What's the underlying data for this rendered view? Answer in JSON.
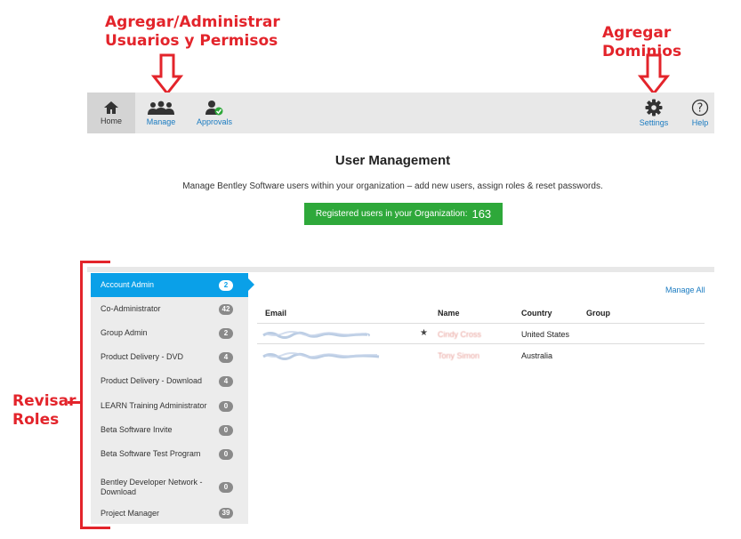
{
  "annotations": {
    "manage_note_line1": "Agregar/Administrar",
    "manage_note_line2": "Usuarios y Permisos",
    "settings_note": "Agregar Dominios",
    "roles_note_line1": "Revisar",
    "roles_note_line2": "Roles",
    "color": "#e3242b"
  },
  "toolbar": {
    "items": [
      {
        "label": "Home",
        "icon": "home-icon",
        "active": true
      },
      {
        "label": "Manage",
        "icon": "users-icon"
      },
      {
        "label": "Approvals",
        "icon": "user-check-icon"
      },
      {
        "label": "Settings",
        "icon": "gear-icon"
      },
      {
        "label": "Help",
        "icon": "help-icon"
      }
    ]
  },
  "page": {
    "title": "User Management",
    "subtitle": "Manage Bentley Software users within your organization – add new users, assign roles & reset passwords.",
    "registered_label": "Registered users in your Organization:",
    "registered_count": "163",
    "accent": "#2ea83a"
  },
  "roles": [
    {
      "label": "Account Admin",
      "count": "2",
      "active": true
    },
    {
      "label": "Co-Administrator",
      "count": "42"
    },
    {
      "label": "Group Admin",
      "count": "2"
    },
    {
      "label": "Product Delivery - DVD",
      "count": "4"
    },
    {
      "label": "Product Delivery - Download",
      "count": "4"
    },
    {
      "label": "LEARN Training Administrator",
      "count": "0"
    },
    {
      "label": "Beta Software Invite",
      "count": "0"
    },
    {
      "label": "Beta Software Test Program",
      "count": "0"
    },
    {
      "label": "Bentley Developer Network - Download",
      "count": "0"
    },
    {
      "label": "Project Manager",
      "count": "39"
    }
  ],
  "table": {
    "manage_all": "Manage All",
    "headers": {
      "email": "Email",
      "name": "Name",
      "country": "Country",
      "group": "Group"
    },
    "rows": [
      {
        "name": "Cindy Cross",
        "country": "United States",
        "starred": true
      },
      {
        "name": "Tony Simon",
        "country": "Australia",
        "starred": false
      }
    ]
  }
}
